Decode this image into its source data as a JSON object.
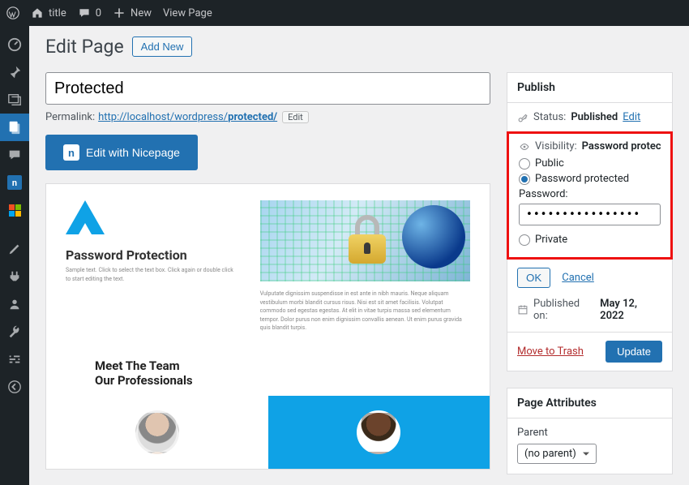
{
  "adminbar": {
    "site_title": "title",
    "comments_count": "0",
    "new_label": "New",
    "view_page_label": "View Page"
  },
  "sidebar": {
    "items": [
      {
        "name": "dashboard-icon"
      },
      {
        "name": "pin-icon"
      },
      {
        "name": "media-icon"
      },
      {
        "name": "pages-icon"
      },
      {
        "name": "comments-icon"
      },
      {
        "name": "nicepage-icon"
      },
      {
        "name": "microsoft-icon"
      },
      {
        "name": "appearance-icon"
      },
      {
        "name": "plugins-icon"
      },
      {
        "name": "users-icon"
      },
      {
        "name": "tools-icon"
      },
      {
        "name": "settings-icon"
      },
      {
        "name": "collapse-icon"
      }
    ],
    "active_index": 3
  },
  "page": {
    "heading": "Edit Page",
    "add_new_label": "Add New",
    "title_value": "Protected",
    "permalink_label": "Permalink:",
    "permalink_base": "http://localhost/wordpress/",
    "permalink_slug": "protected/",
    "permalink_edit": "Edit",
    "np_button": "Edit with Nicepage"
  },
  "preview": {
    "section1_heading": "Password Protection",
    "section1_text": "Sample text. Click to select the text box. Click again or double click to start editing the text.",
    "section1_img_alt": "padlock and globe",
    "section1_right_text": "Vulputate dignissim suspendisse in est ante in nibh mauris. Neque aliquam vestibulum morbi blandit cursus risus. Nisi est sit amet facilisis. Volutpat commodo sed egestas egestas. At elit in vitae turpis massa sed elementum tempor. Dolor purus non enim dignissim convallis aenean. Ut enim purus gravida quis blandit turpis.",
    "team_heading1": "Meet The Team",
    "team_heading2": "Our Professionals"
  },
  "publish": {
    "box_title": "Publish",
    "status_label": "Status:",
    "status_value": "Published",
    "status_edit": "Edit",
    "visibility_label": "Visibility:",
    "visibility_value": "Password protected",
    "radio_public": "Public",
    "radio_password": "Password protected",
    "password_label": "Password:",
    "password_value": "••••••••••••••••",
    "radio_private": "Private",
    "ok_label": "OK",
    "cancel_label": "Cancel",
    "published_label": "Published on:",
    "published_value": "May 12, 2022",
    "trash_label": "Move to Trash",
    "update_label": "Update"
  },
  "page_attributes": {
    "box_title": "Page Attributes",
    "parent_label": "Parent",
    "parent_value": "(no parent)"
  }
}
